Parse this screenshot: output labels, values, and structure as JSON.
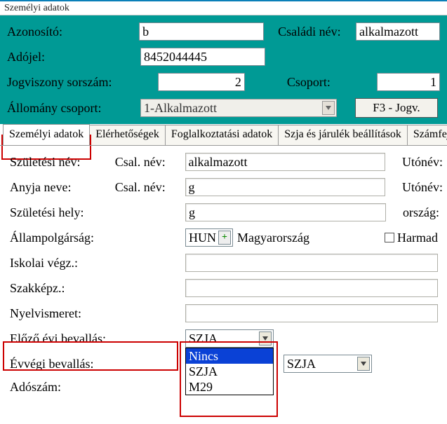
{
  "titlebar": "Személyi adatok",
  "header": {
    "id_label": "Azonosító:",
    "id_value": "b",
    "family_label": "Családi név:",
    "family_value": "alkalmazott",
    "tax_label": "Adójel:",
    "tax_value": "8452044445",
    "rel_label": "Jogviszony sorszám:",
    "rel_value": "2",
    "group_label": "Csoport:",
    "group_value": "1",
    "stock_label": "Állomány csoport:",
    "stock_value": "1-Alkalmazott",
    "f3_label": "F3 - Jogv."
  },
  "tabs": [
    "Személyi adatok",
    "Elérhetőségek",
    "Foglalkoztatási adatok",
    "Szja és járulék beállítások",
    "Számfejtési beáll"
  ],
  "form": {
    "birth_name_label": "Születési név:",
    "csal_label": "Csal. név:",
    "birth_name_value": "alkalmazott",
    "utonev_label": "Utónév:",
    "mother_label": "Anyja neve:",
    "mother_value": "g",
    "birthplace_label": "Születési hely:",
    "birthplace_value": "g",
    "country_label": "ország:",
    "citizenship_label": "Állampolgárság:",
    "citizenship_code": "HUN",
    "citizenship_name": "Magyarország",
    "third_country_label": "Harmad",
    "edu_label": "Iskolai végz.:",
    "vocation_label": "Szakképz.:",
    "language_label": "Nyelvismeret:",
    "prev_return_label": "Előző évi bevallás:",
    "prev_return_value": "SZJA",
    "prev_return_options": [
      "Nincs",
      "SZJA",
      "M29"
    ],
    "year_end_label": "Évvégi bevallás:",
    "year_end_value2": "SZJA",
    "tax_num_label": "Adószám:"
  }
}
